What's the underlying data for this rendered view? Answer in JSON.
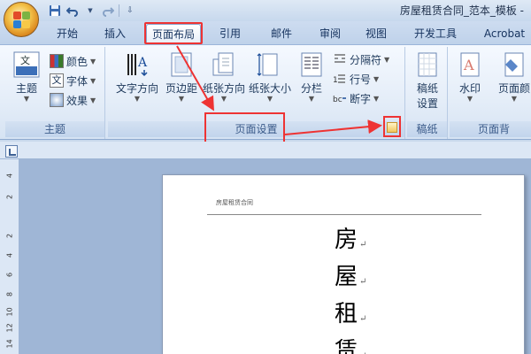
{
  "window": {
    "title": "房屋租赁合同_范本_模板 -"
  },
  "quick_access": {
    "save_icon": "save-icon",
    "undo_icon": "undo-icon",
    "redo_icon": "redo-icon",
    "customize_icon": "customize-icon"
  },
  "tabs": [
    {
      "label": "开始"
    },
    {
      "label": "插入"
    },
    {
      "label": "页面布局"
    },
    {
      "label": "引用"
    },
    {
      "label": "邮件"
    },
    {
      "label": "审阅"
    },
    {
      "label": "视图"
    },
    {
      "label": "开发工具"
    },
    {
      "label": "Acrobat"
    }
  ],
  "ribbon": {
    "themes": {
      "group_label": "主题",
      "theme_button": "主题",
      "colors": "颜色",
      "fonts": "字体",
      "effects": "效果"
    },
    "page_setup": {
      "group_label": "页面设置",
      "text_direction": "文字方向",
      "margins": "页边距",
      "orientation": "纸张方向",
      "size": "纸张大小",
      "columns": "分栏",
      "breaks": "分隔符",
      "line_numbers": "行号",
      "hyphenation": "断字"
    },
    "manuscript": {
      "group_label": "稿纸",
      "manuscript_settings": "稿纸",
      "manuscript_settings_2": "设置"
    },
    "page_background": {
      "group_label": "页面背",
      "watermark": "水印",
      "page_color": "页面颜"
    }
  },
  "ruler": {
    "left_numbers": [
      "4",
      "2",
      "2",
      "4",
      "6",
      "8",
      "10",
      "12",
      "14"
    ]
  },
  "document": {
    "header_text": "房屋租赁合同",
    "title_chars": [
      "房",
      "屋",
      "租",
      "赁"
    ],
    "paragraph_mark": "↵"
  },
  "colors": {
    "highlight": "#ee3333",
    "accent": "#d9831a"
  }
}
